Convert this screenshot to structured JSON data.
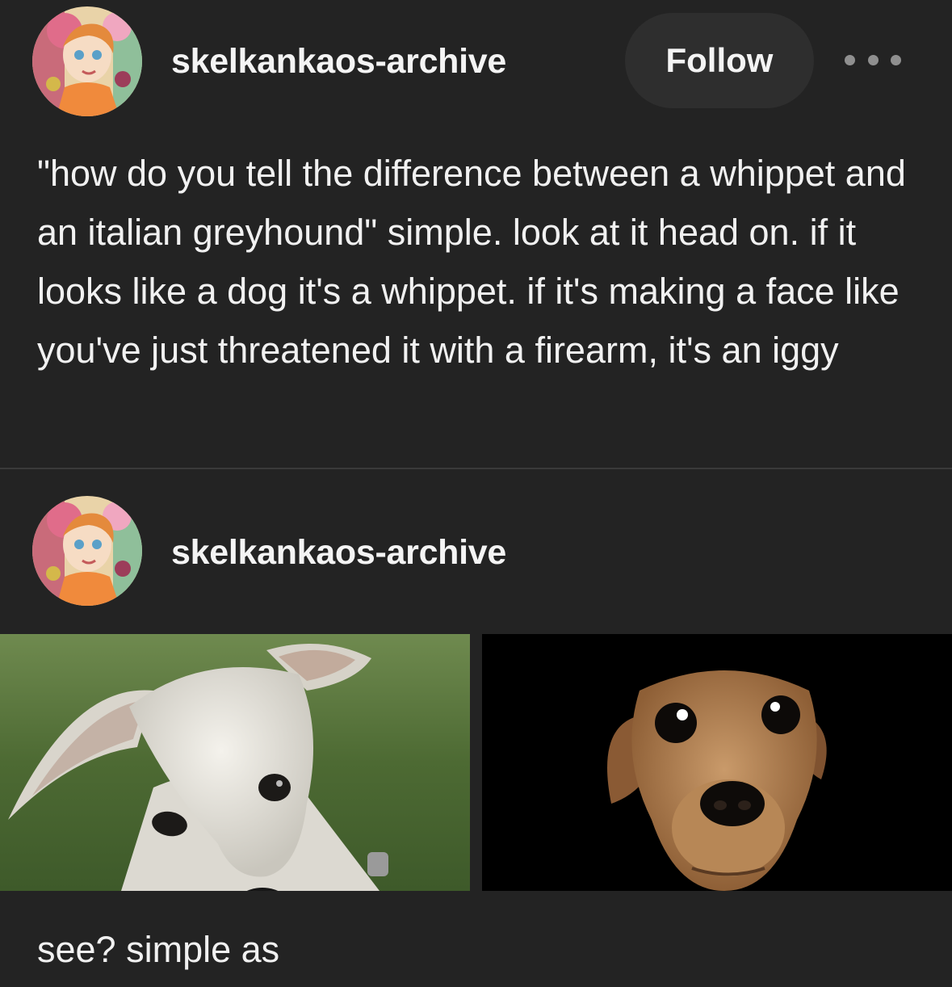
{
  "post": {
    "username": "skelkankaos-archive",
    "follow_label": "Follow",
    "text": "\"how do you tell the difference between a whippet and an italian greyhound\" simple. look at it head on. if it looks like a dog it's a whippet. if it's making a face like you've just threatened it with a firearm, it's an iggy"
  },
  "reblog": {
    "username": "skelkankaos-archive",
    "caption": "see? simple as"
  },
  "icons": {
    "more": "more-options-icon"
  },
  "colors": {
    "background": "#232323",
    "text": "#f1f1f1",
    "button_bg": "#2e2e2e",
    "divider": "#3a3a3a"
  }
}
